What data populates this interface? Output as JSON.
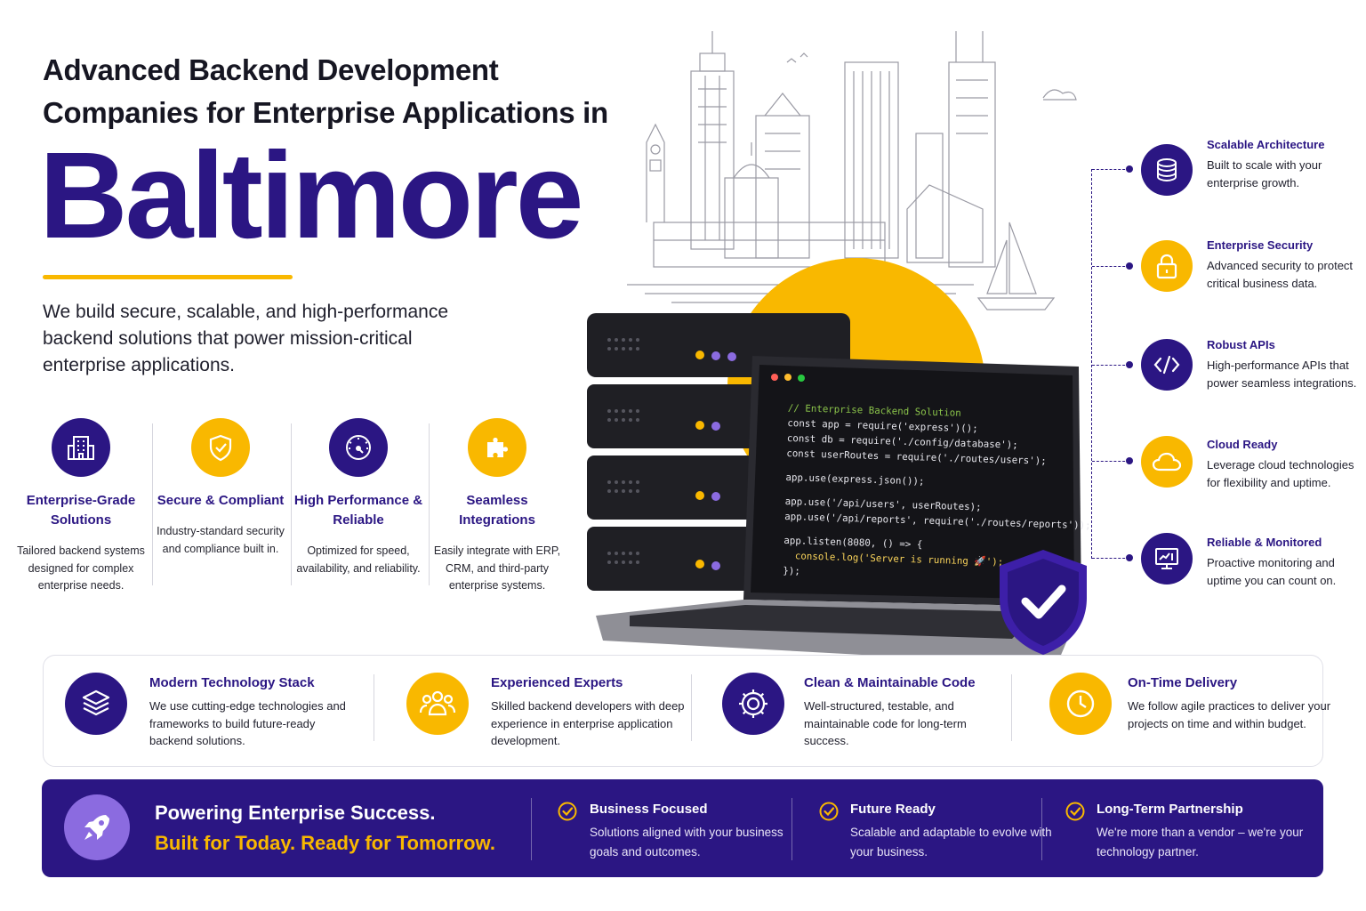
{
  "header": {
    "title_line1": "Advanced Backend Development",
    "title_line2": "Companies for Enterprise Applications in",
    "city": "Baltimore",
    "subtitle": "We build secure, scalable, and high-performance backend solutions that power mission-critical enterprise applications."
  },
  "features": [
    {
      "icon": "enterprise-building-icon",
      "title": "Enterprise-Grade Solutions",
      "desc": "Tailored backend systems designed for complex enterprise needs."
    },
    {
      "icon": "shield-check-icon",
      "title": "Secure & Compliant",
      "desc": "Industry-standard security and compliance built in."
    },
    {
      "icon": "speedometer-icon",
      "title": "High Performance & Reliable",
      "desc": "Optimized for speed, availability, and reliability."
    },
    {
      "icon": "puzzle-piece-icon",
      "title": "Seamless Integrations",
      "desc": "Easily integrate with ERP, CRM, and third-party enterprise systems."
    }
  ],
  "right_items": [
    {
      "icon": "database-icon",
      "title": "Scalable Architecture",
      "desc": "Built to scale with your enterprise growth."
    },
    {
      "icon": "lock-icon",
      "title": "Enterprise Security",
      "desc": "Advanced security to protect critical business data."
    },
    {
      "icon": "code-brackets-icon",
      "title": "Robust APIs",
      "desc": "High-performance APIs that power seamless integrations."
    },
    {
      "icon": "cloud-icon",
      "title": "Cloud Ready",
      "desc": "Leverage cloud technologies for flexibility and uptime."
    },
    {
      "icon": "monitor-chart-icon",
      "title": "Reliable & Monitored",
      "desc": "Proactive monitoring and uptime you can count on."
    }
  ],
  "card_items": [
    {
      "icon": "layers-icon",
      "title": "Modern Technology Stack",
      "desc": "We use cutting-edge technologies and frameworks to build future-ready backend solutions."
    },
    {
      "icon": "team-icon",
      "title": "Experienced Experts",
      "desc": "Skilled backend developers with deep experience in enterprise application development."
    },
    {
      "icon": "gear-icon",
      "title": "Clean & Maintainable Code",
      "desc": "Well-structured, testable, and maintainable code for long-term success."
    },
    {
      "icon": "clock-icon",
      "title": "On-Time Delivery",
      "desc": "We follow agile practices to deliver your projects on time and within budget."
    }
  ],
  "banner": {
    "line1": "Powering Enterprise Success.",
    "line2": "Built for Today. Ready for Tomorrow.",
    "items": [
      {
        "title": "Business Focused",
        "desc": "Solutions aligned with your business goals and outcomes."
      },
      {
        "title": "Future Ready",
        "desc": "Scalable and adaptable to evolve with your business."
      },
      {
        "title": "Long-Term Partnership",
        "desc": "We're more than a vendor – we're your technology partner."
      }
    ]
  },
  "code": {
    "line1": "// Enterprise Backend Solution",
    "line2": "const app = require('express')();",
    "line3": "const db = require('./config/database');",
    "line4": "const userRoutes = require('./routes/users');",
    "line5": "app.use(express.json());",
    "line6": "app.use('/api/users', userRoutes);",
    "line7": "app.use('/api/reports', require('./routes/reports'));",
    "line8": "app.listen(8080, () => {",
    "line9": "  console.log('Server is running 🚀');",
    "line10": "});"
  },
  "colors": {
    "primary_purple": "#2b1683",
    "accent_yellow": "#f9b800",
    "light_purple": "#8b6be0"
  }
}
